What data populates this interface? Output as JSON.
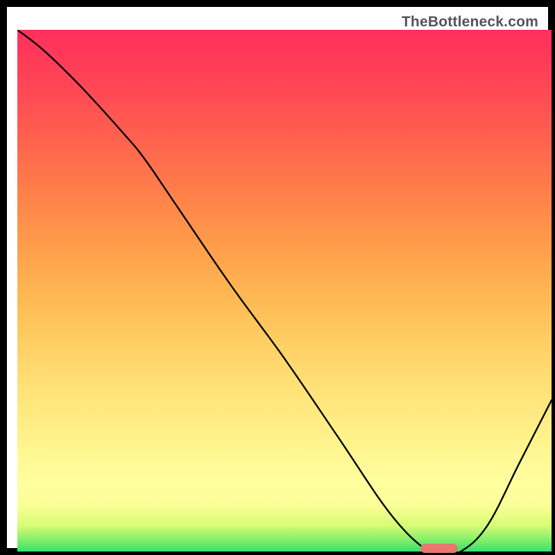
{
  "watermark": "TheBottleneck.com",
  "colors": {
    "background": "#000000",
    "frame": "#ffffff",
    "curve": "#000000",
    "marker": "#e8756f"
  },
  "chart_data": {
    "type": "line",
    "title": "",
    "xlabel": "",
    "ylabel": "",
    "xlim": [
      0,
      100
    ],
    "ylim": [
      0,
      100
    ],
    "x": [
      0,
      5,
      12,
      20,
      24,
      30,
      40,
      50,
      60,
      70,
      77,
      80,
      83,
      88,
      94,
      100
    ],
    "values": [
      100,
      96,
      89,
      80,
      75,
      66,
      51,
      37,
      22,
      7,
      0,
      0,
      0,
      5,
      17,
      29
    ],
    "annotations": [
      {
        "kind": "marker-bar",
        "x_center": 79,
        "y": 0,
        "width_pct": 7
      }
    ]
  },
  "gradient_stops": [
    {
      "pos": 0,
      "color": "#33e36b"
    },
    {
      "pos": 2.5,
      "color": "#8cf06a"
    },
    {
      "pos": 5,
      "color": "#d8fb75"
    },
    {
      "pos": 9,
      "color": "#fbff97"
    },
    {
      "pos": 13,
      "color": "#fffea0"
    },
    {
      "pos": 20,
      "color": "#fff58f"
    },
    {
      "pos": 30,
      "color": "#ffe47a"
    },
    {
      "pos": 40,
      "color": "#ffcf64"
    },
    {
      "pos": 50,
      "color": "#ffb552"
    },
    {
      "pos": 60,
      "color": "#ff994a"
    },
    {
      "pos": 70,
      "color": "#ff7c4a"
    },
    {
      "pos": 80,
      "color": "#ff5f4f"
    },
    {
      "pos": 90,
      "color": "#ff4456"
    },
    {
      "pos": 100,
      "color": "#ff2f5c"
    }
  ]
}
